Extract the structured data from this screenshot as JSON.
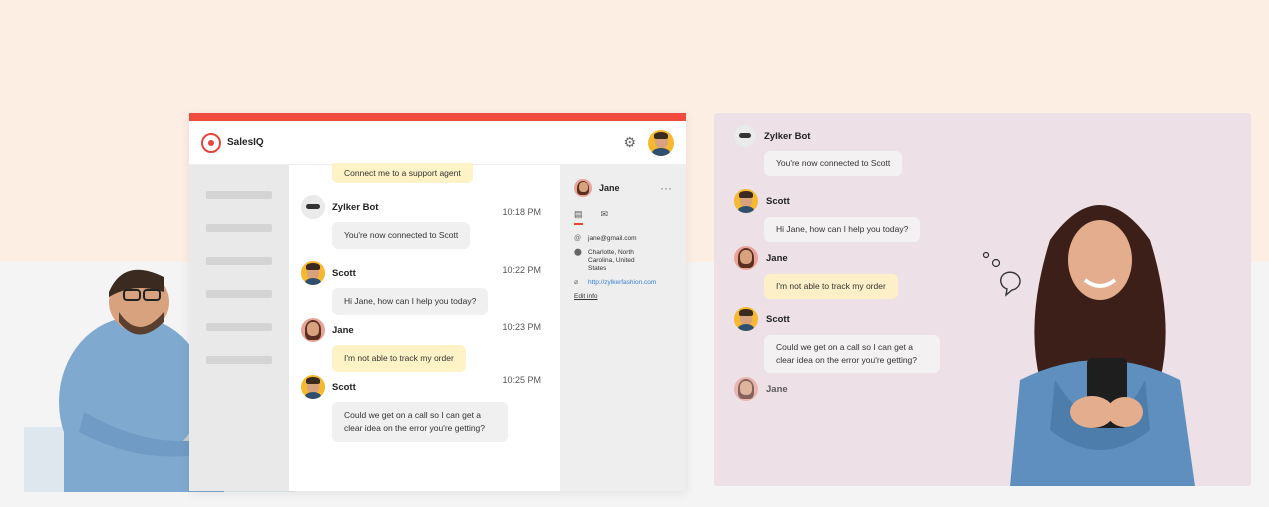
{
  "operator": {
    "app_name": "SalesIQ",
    "top_message": "Connect me to a support agent",
    "messages": [
      {
        "sender": "Zylker Bot",
        "time": "10:18 PM",
        "text": "You're now connected to Scott"
      },
      {
        "sender": "Scott",
        "time": "10:22 PM",
        "text": "Hi  Jane,   how can I help you today?"
      },
      {
        "sender": "Jane",
        "time": "10:23 PM",
        "text": "I'm not able to track my order"
      },
      {
        "sender": "Scott",
        "time": "10:25 PM",
        "text": "Could we get on a call so I can get a clear idea on the error you're getting?"
      }
    ],
    "visitor": {
      "name": "Jane",
      "email": "jane@gmail.com",
      "location": "Charlotte, North Carolina, United States",
      "website": "http://zylkerfashion.com",
      "edit_label": "Edit info"
    }
  },
  "visitor_chat": {
    "messages": [
      {
        "sender": "Zylker Bot",
        "text": "You're now connected to Scott"
      },
      {
        "sender": "Scott",
        "text": "Hi  Jane,   how can I help you today?"
      },
      {
        "sender": "Jane",
        "text": "I'm not able to track my order"
      },
      {
        "sender": "Scott",
        "text": "Could we get on a call so I can get a clear idea on the error you're getting?"
      },
      {
        "sender": "Jane",
        "text": ""
      }
    ]
  },
  "colors": {
    "brand": "#f04b3e",
    "bubble_yellow": "#fdf3c7",
    "accent_link": "#3b7fd0"
  },
  "icons": [
    "gear-icon",
    "more-options-icon",
    "id-card-icon",
    "mail-icon",
    "at-icon",
    "location-icon",
    "link-icon"
  ]
}
